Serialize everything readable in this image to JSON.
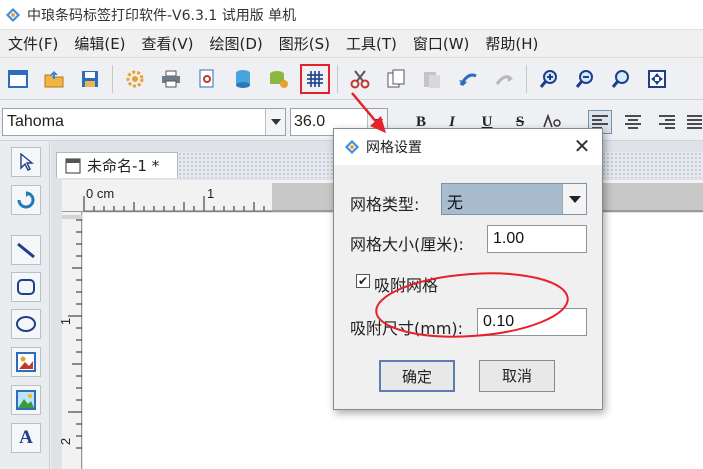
{
  "window": {
    "title": "中琅条码标签打印软件-V6.3.1 试用版 单机"
  },
  "menu": {
    "items": [
      "文件(F)",
      "编辑(E)",
      "查看(V)",
      "绘图(D)",
      "图形(S)",
      "工具(T)",
      "窗口(W)",
      "帮助(H)"
    ]
  },
  "format": {
    "font": "Tahoma",
    "size": "36.0",
    "bold": "B",
    "italic": "I",
    "underline": "U",
    "strike": "S"
  },
  "doc": {
    "tab": "未命名-1 *"
  },
  "ruler": {
    "unit": "0 cm",
    "h_mark_1": "1",
    "v_mark_1": "1",
    "v_mark_2": "2"
  },
  "palette": {
    "text_tool": "A"
  },
  "dialog": {
    "title": "网格设置",
    "close": "✕",
    "grid_type_label": "网格类型:",
    "grid_type_value": "无",
    "grid_size_label": "网格大小(厘米):",
    "grid_size_value": "1.00",
    "snap_label": "吸附网格",
    "snap_checked": true,
    "snap_size_label": "吸附尺寸(mm):",
    "snap_size_value": "0.10",
    "ok": "确定",
    "cancel": "取消"
  },
  "colors": {
    "annotation": "#e8202a",
    "accent": "#5a7fb0"
  }
}
